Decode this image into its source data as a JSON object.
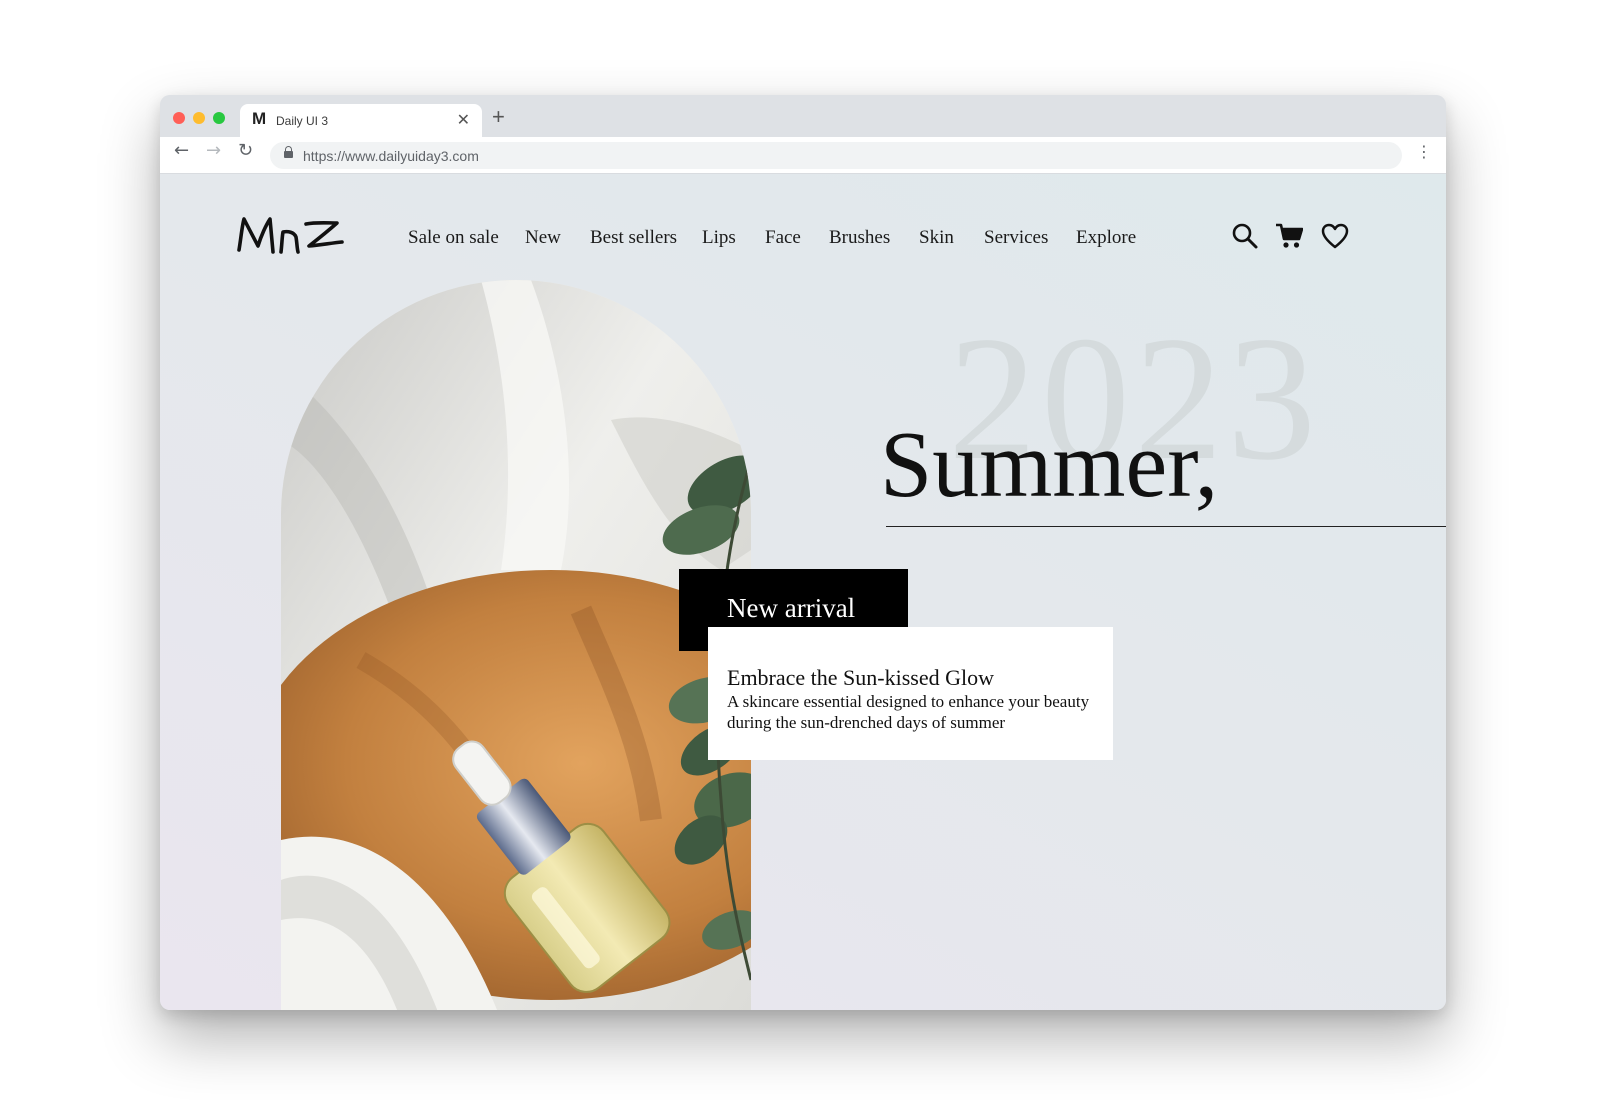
{
  "browser": {
    "tab": {
      "favicon": "M",
      "title": "Daily UI 3",
      "close": "✕"
    },
    "new_tab": "+",
    "nav": {
      "back": "←",
      "forward": "→",
      "reload": "↻"
    },
    "url": "https://www.dailyuiday3.com",
    "menu": "⋮",
    "traffic_lights": [
      "#ff5f57",
      "#febc2e",
      "#28c840"
    ]
  },
  "site": {
    "logo_text": "Mnz",
    "nav_items": [
      "Sale on sale",
      "New",
      "Best sellers",
      "Lips",
      "Face",
      "Brushes",
      "Skin",
      "Services",
      "Explore"
    ],
    "icons": [
      "search-icon",
      "cart-icon",
      "heart-icon"
    ]
  },
  "hero": {
    "year": "2023",
    "headline": "Summer,",
    "tag": "New arrival",
    "card_title": "Embrace the Sun-kissed Glow",
    "card_text": "A skincare essential designed to enhance your beauty during the sun-drenched days of summer"
  }
}
